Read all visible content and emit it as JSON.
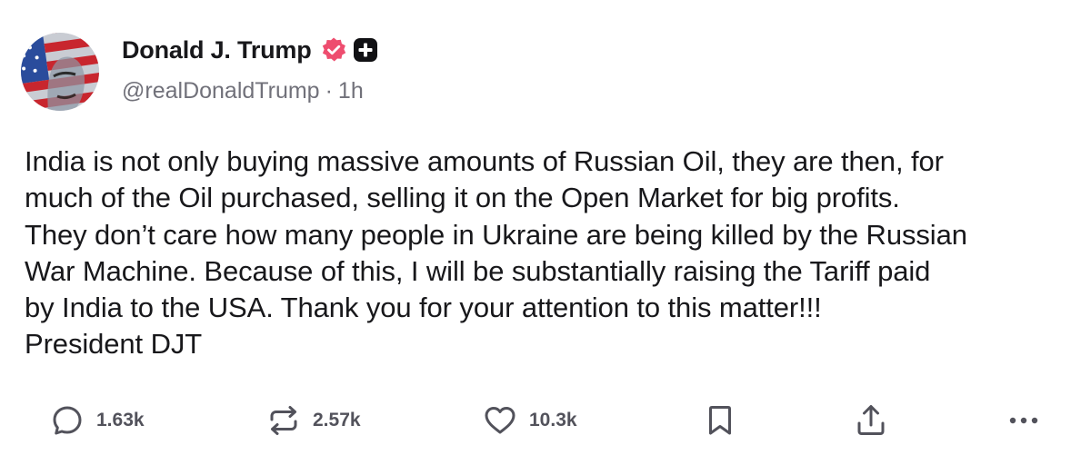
{
  "author": {
    "display_name": "Donald J. Trump",
    "handle": "@realDonaldTrump",
    "separator": "·",
    "timestamp": "1h",
    "verified_color": "#ee4d6f"
  },
  "post": {
    "text": "India is not only buying massive amounts of Russian Oil, they are then, for\nmuch of the Oil purchased, selling it on the Open Market for big profits.\nThey don’t care how many people in Ukraine are being killed by the Russian\nWar Machine. Because of this, I will be substantially raising the Tariff paid\nby India to the USA. Thank you for your attention to this matter!!!\nPresident DJT"
  },
  "actions": {
    "replies": "1.63k",
    "reposts": "2.57k",
    "likes": "10.3k",
    "icons": [
      "reply-icon",
      "repost-icon",
      "heart-icon",
      "bookmark-icon",
      "share-icon",
      "more-icon"
    ]
  },
  "colors": {
    "text": "#18181b",
    "muted": "#71717a",
    "icon": "#52525b"
  }
}
